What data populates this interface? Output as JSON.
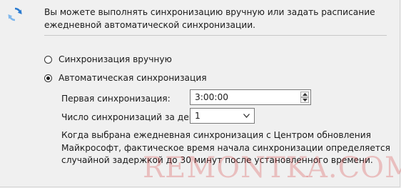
{
  "header": {
    "icon": "sync-icon",
    "text": "Вы можете выполнять синхронизацию вручную или задать расписание ежедневной автоматической синхронизации."
  },
  "options": {
    "manual_label": "Синхронизация вручную",
    "auto_label": "Автоматическая синхронизация",
    "selected": "auto"
  },
  "schedule": {
    "first_sync_label": "Первая синхронизация:",
    "first_sync_value": "3:00:00",
    "count_label": "Число синхронизаций за день:",
    "count_value": "1"
  },
  "description": "Когда выбрана ежедневная синхронизация с Центром обновления Майкрософт, фактическое время начала синхронизации определяется случайной задержкой до 30 минут после установленного времени.",
  "watermark": "REMONTKA.COM",
  "colors": {
    "icon_blue": "#2b7bd0",
    "icon_light": "#7fb7ec",
    "watermark": "#d73c3c"
  }
}
